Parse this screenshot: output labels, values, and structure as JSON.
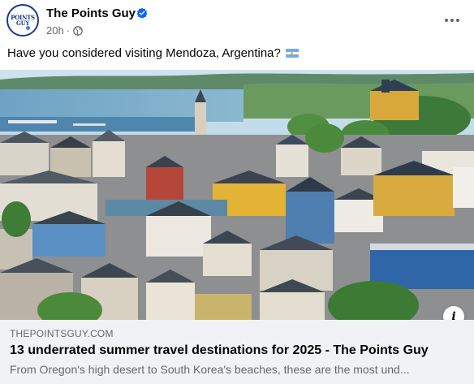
{
  "post": {
    "page_name": "The Points Guy",
    "avatar_line1": "POINTS",
    "avatar_line2": "GUY",
    "time": "20h",
    "separator": "·",
    "caption": "Have you considered visiting Mendoza, Argentina?"
  },
  "link_preview": {
    "domain": "THEPOINTSGUY.COM",
    "title": "13 underrated summer travel destinations for 2025 - The Points Guy",
    "description": "From Oregon's high desert to South Korea's beaches, these are the most und..."
  },
  "icons": {
    "verified": "verified-badge-icon",
    "privacy": "globe-icon",
    "more": "more-options-icon",
    "info": "info-icon",
    "flag": "argentina-flag-icon"
  },
  "colors": {
    "verified_blue": "#0866ff",
    "meta_gray": "#65676b",
    "preview_bg": "#f0f2f5"
  }
}
